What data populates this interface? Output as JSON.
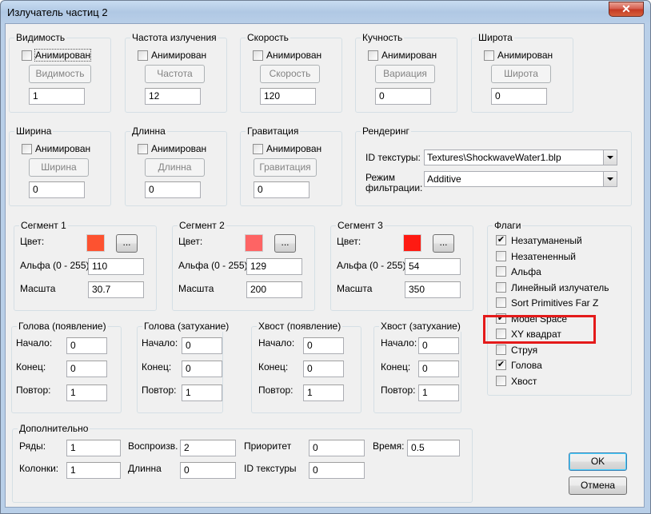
{
  "window": {
    "title": "Излучатель частиц 2",
    "close_glyph": "✕"
  },
  "common": {
    "animated_label": "Анимирован",
    "checkmark": "✔"
  },
  "visibility": {
    "title": "Видимость",
    "animated": false,
    "button": "Видимость",
    "value": "1"
  },
  "emission_rate": {
    "title": "Частота излучения",
    "animated": false,
    "button": "Частота",
    "value": "12"
  },
  "speed": {
    "title": "Скорость",
    "animated": false,
    "button": "Скорость",
    "value": "120"
  },
  "clumping": {
    "title": "Кучность",
    "animated": false,
    "button": "Вариация",
    "value": "0"
  },
  "latitude": {
    "title": "Широта",
    "animated": false,
    "button": "Широта",
    "value": "0"
  },
  "width": {
    "title": "Ширина",
    "animated": false,
    "button": "Ширина",
    "value": "0"
  },
  "length": {
    "title": "Длинна",
    "animated": false,
    "button": "Длинна",
    "value": "0"
  },
  "gravity": {
    "title": "Гравитация",
    "animated": false,
    "button": "Гравитация",
    "value": "0"
  },
  "rendering": {
    "title": "Рендеринг",
    "texture_label": "ID текстуры:",
    "texture_value": "Textures\\ShockwaveWater1.blp",
    "filter_label_1": "Режим",
    "filter_label_2": "фильтрации:",
    "filter_value": "Additive"
  },
  "segment1": {
    "title": "Сегмент 1",
    "color_label": "Цвет:",
    "color": "#fd5230",
    "pick": "...",
    "alpha_label": "Альфа (0 - 255)",
    "alpha": "110",
    "scale_label": "Масшта",
    "scale": "30.7"
  },
  "segment2": {
    "title": "Сегмент 2",
    "color_label": "Цвет:",
    "color": "#fe6464",
    "pick": "...",
    "alpha_label": "Альфа (0 - 255)",
    "alpha": "129",
    "scale_label": "Масшта",
    "scale": "200"
  },
  "segment3": {
    "title": "Сегмент 3",
    "color_label": "Цвет:",
    "color": "#fe1a12",
    "pick": "...",
    "alpha_label": "Альфа (0 - 255)",
    "alpha": "54",
    "scale_label": "Масшта",
    "scale": "350"
  },
  "head_birth": {
    "title": "Голова (появление)",
    "start_label": "Начало:",
    "start": "0",
    "end_label": "Конец:",
    "end": "0",
    "repeat_label": "Повтор:",
    "repeat": "1"
  },
  "head_decay": {
    "title": "Голова (затухание)",
    "start_label": "Начало:",
    "start": "0",
    "end_label": "Конец:",
    "end": "0",
    "repeat_label": "Повтор:",
    "repeat": "1"
  },
  "tail_birth": {
    "title": "Хвост (появление)",
    "start_label": "Начало:",
    "start": "0",
    "end_label": "Конец:",
    "end": "0",
    "repeat_label": "Повтор:",
    "repeat": "1"
  },
  "tail_decay": {
    "title": "Хвост (затухание)",
    "start_label": "Начало:",
    "start": "0",
    "end_label": "Конец:",
    "end": "0",
    "repeat_label": "Повтор:",
    "repeat": "1"
  },
  "flags": {
    "title": "Флаги",
    "items": [
      {
        "label": "Незатуманеный",
        "checked": true
      },
      {
        "label": "Незатененный",
        "checked": false
      },
      {
        "label": "Альфа",
        "checked": false
      },
      {
        "label": "Линейный излучатель",
        "checked": false
      },
      {
        "label": "Sort Primitives Far Z",
        "checked": false
      },
      {
        "label": "Model Space",
        "checked": true
      },
      {
        "label": "XY квадрат",
        "checked": false
      },
      {
        "label": "Струя",
        "checked": false
      },
      {
        "label": "Голова",
        "checked": true
      },
      {
        "label": "Хвост",
        "checked": false
      }
    ]
  },
  "extra": {
    "title": "Дополнительно",
    "rows_label": "Ряды:",
    "rows": "1",
    "columns_label": "Колонки:",
    "columns": "1",
    "playback_label": "Воспроизв.",
    "playback": "2",
    "length_label": "Длинна",
    "length": "0",
    "priority_label": "Приоритет",
    "priority": "0",
    "texture_label": "ID текстуры",
    "texture": "0",
    "time_label": "Время:",
    "time": "0.5"
  },
  "buttons": {
    "ok": "OK",
    "cancel": "Отмена"
  },
  "highlight_color": "#e41a1a"
}
